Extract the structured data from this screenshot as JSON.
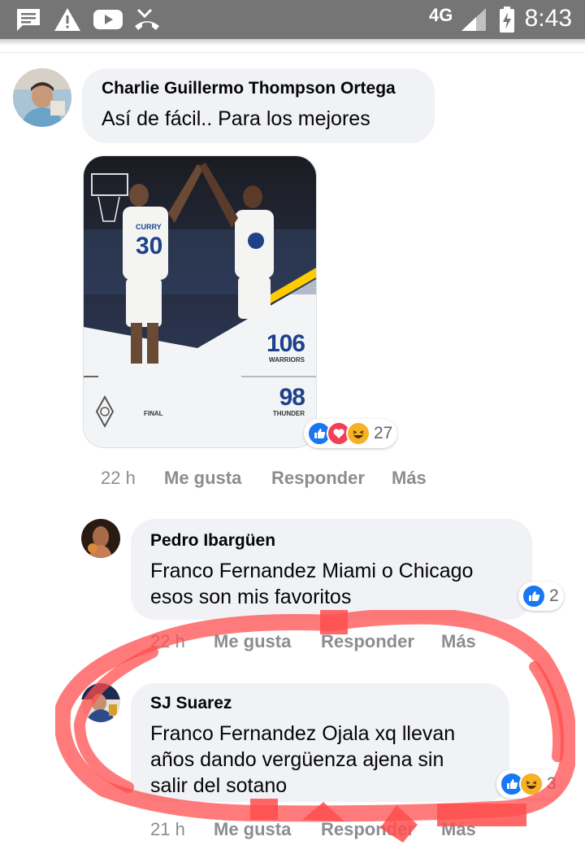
{
  "status_bar": {
    "network": "4G",
    "time": "8:43",
    "icons": [
      "message-icon",
      "warning-icon",
      "youtube-icon",
      "missed-call-icon",
      "signal-icon",
      "battery-charging-icon"
    ]
  },
  "comments": [
    {
      "author": "Charlie Guillermo Thompson Ortega",
      "text": "Así de fácil.. Para los mejores",
      "image": {
        "jersey_name": "CURRY",
        "jersey_number": "30",
        "home_score": "106",
        "home_team": "WARRIORS",
        "away_score": "98",
        "away_team": "THUNDER",
        "status": "FINAL"
      },
      "reactions": [
        "like",
        "love",
        "haha"
      ],
      "reaction_count": "27",
      "time": "22 h",
      "like_label": "Me gusta",
      "reply_label": "Responder",
      "more_label": "Más"
    },
    {
      "author": "Pedro Ibargüen",
      "text_line1": "Franco Fernandez Miami o Chicago",
      "text_line2": "esos son mis favoritos",
      "reactions": [
        "like"
      ],
      "reaction_count": "2",
      "time": "22 h",
      "like_label": "Me gusta",
      "reply_label": "Responder",
      "more_label": "Más"
    },
    {
      "author": "SJ Suarez",
      "text_line1": "Franco Fernandez Ojala xq llevan",
      "text_line2": "años dando vergüenza ajena sin",
      "text_line3": "salir del sotano",
      "reactions": [
        "like",
        "haha"
      ],
      "reaction_count": "3",
      "time": "21 h",
      "like_label": "Me gusta",
      "reply_label": "Responder",
      "more_label": "Más"
    }
  ],
  "colors": {
    "status_bar": "#757575",
    "bubble": "#f0f2f5",
    "like_blue": "#1877f2",
    "love_red": "#f33e58",
    "haha_yellow": "#f7b125",
    "annotation_red": "#ff5a5a"
  }
}
